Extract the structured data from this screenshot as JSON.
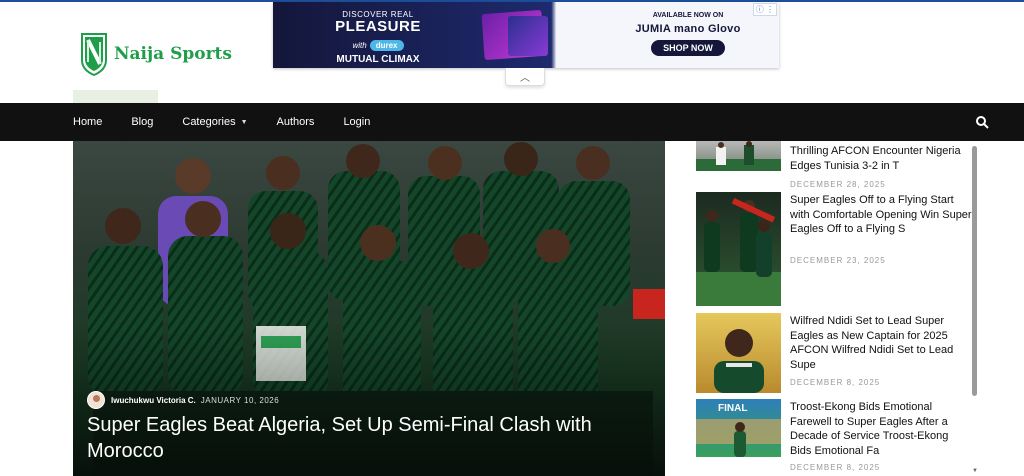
{
  "site": {
    "name": "Naija Sports",
    "brand_color": "#1f9e4a"
  },
  "ad": {
    "discover": "DISCOVER REAL",
    "headline": "PLEASURE",
    "with": "with",
    "brand": "durex",
    "product": "MUTUAL CLIMAX",
    "available": "AVAILABLE NOW ON",
    "stores": "JUMIA  mano  Glovo",
    "cta": "SHOP NOW"
  },
  "nav": {
    "items": [
      {
        "label": "Home"
      },
      {
        "label": "Blog"
      },
      {
        "label": "Categories",
        "has_dropdown": true
      },
      {
        "label": "Authors"
      },
      {
        "label": "Login"
      }
    ],
    "search_icon": "search-icon"
  },
  "hero": {
    "author": "Iwuchukwu Victoria C.",
    "date": "JANUARY 10, 2026",
    "title": "Super Eagles Beat Algeria, Set Up Semi-Final Clash with Morocco"
  },
  "sidebar": {
    "posts": [
      {
        "title": "Thrilling AFCON Encounter Nigeria Edges Tunisia 3-2 in T",
        "date": "DECEMBER 28, 2025"
      },
      {
        "title": "Super Eagles Off to a Flying Start with Comfortable Opening Win Super Eagles Off to a Flying S",
        "date": "DECEMBER 23, 2025"
      },
      {
        "title": "Wilfred Ndidi Set to Lead Super Eagles as New Captain for 2025 AFCON Wilfred Ndidi Set to Lead Supe",
        "date": "DECEMBER 8, 2025"
      },
      {
        "title": "Troost-Ekong Bids Emotional Farewell to Super Eagles After a Decade of Service Troost-Ekong Bids Emotional Fa",
        "date": "DECEMBER 8, 2025"
      }
    ],
    "thumb_text_final": "FINAL"
  }
}
